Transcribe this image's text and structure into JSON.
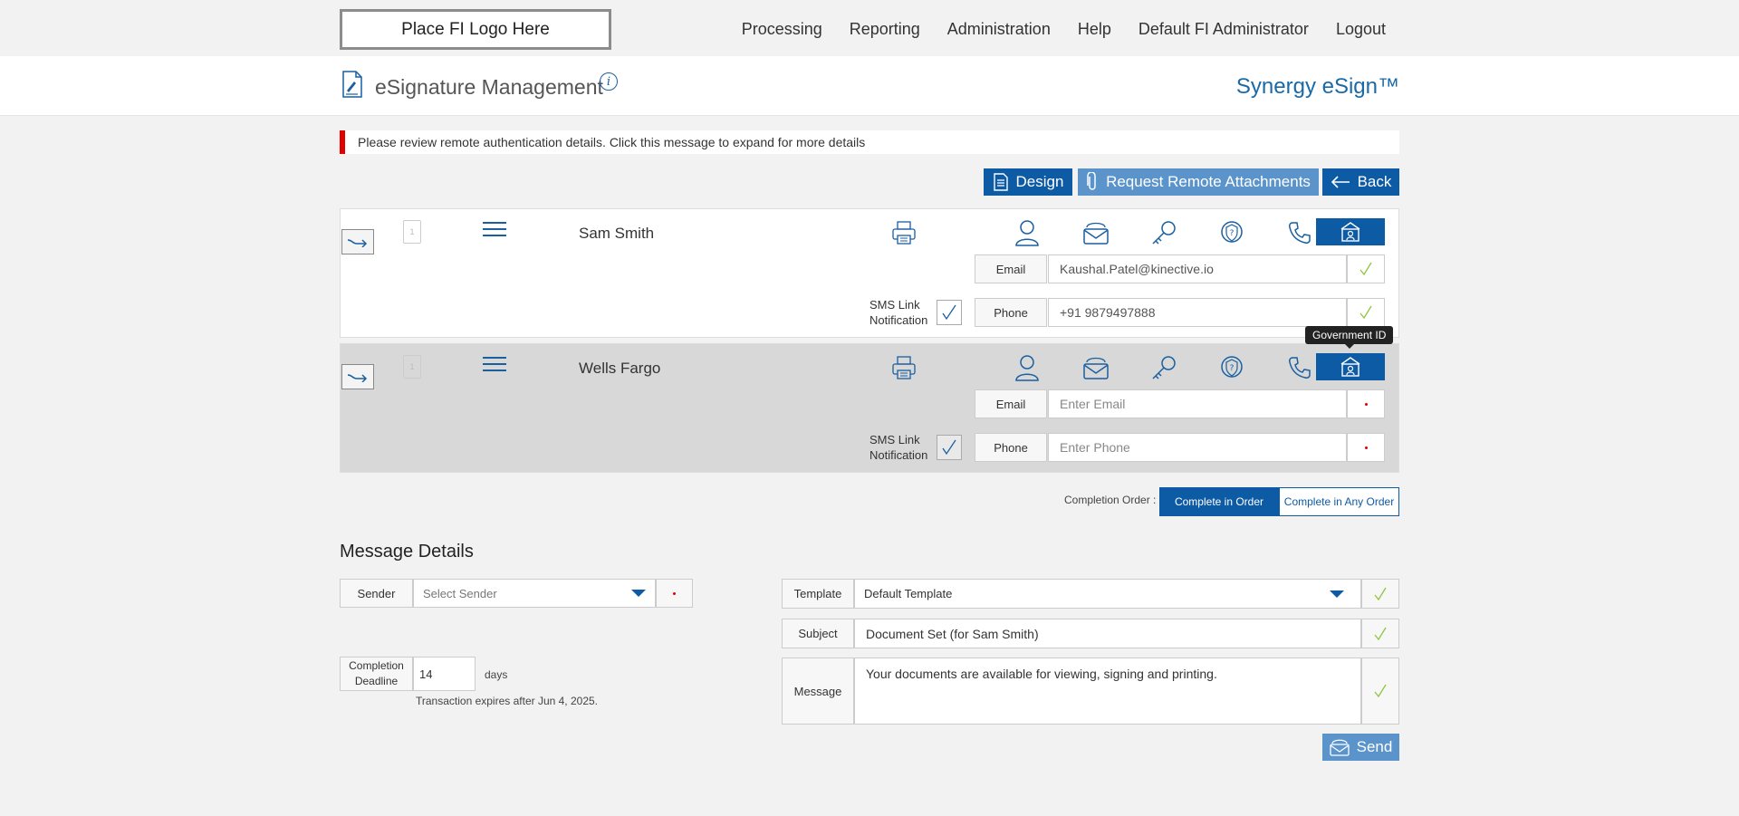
{
  "nav": {
    "logo_text": "Place FI Logo Here",
    "items": [
      "Processing",
      "Reporting",
      "Administration",
      "Help",
      "Default FI Administrator",
      "Logout"
    ]
  },
  "header": {
    "title": "eSignature Management",
    "info_glyph": "i",
    "brand": "Synergy eSign™"
  },
  "alert": {
    "text": "Please review remote authentication details. Click this message to expand for more details"
  },
  "actions": {
    "design": "Design",
    "request_attachments": "Request Remote Attachments",
    "back": "Back"
  },
  "recipients": [
    {
      "name": "Sam Smith",
      "page_number": "1",
      "email_label": "Email",
      "email_value": "Kaushal.Patel@kinective.io",
      "phone_label": "Phone",
      "phone_value": "+91 9879497888",
      "sms_label_1": "SMS Link",
      "sms_label_2": "Notification"
    },
    {
      "name": "Wells Fargo",
      "page_number": "1",
      "email_label": "Email",
      "email_placeholder": "Enter Email",
      "phone_label": "Phone",
      "phone_placeholder": "Enter Phone",
      "sms_label_1": "SMS Link",
      "sms_label_2": "Notification",
      "tooltip": "Government ID"
    }
  ],
  "auth_icons": [
    "user-icon",
    "envelope-icon",
    "key-icon",
    "shield-question-icon",
    "phone-icon",
    "government-id-icon"
  ],
  "completion_order": {
    "label": "Completion Order :",
    "in_order": "Complete in Order",
    "any_order": "Complete in Any Order"
  },
  "message_details": {
    "title": "Message Details",
    "sender_label": "Sender",
    "sender_placeholder": "Select Sender",
    "deadline_label_1": "Completion",
    "deadline_label_2": "Deadline",
    "deadline_value": "14",
    "deadline_unit": "days",
    "expiry_note": "Transaction expires after Jun 4, 2025.",
    "template_label": "Template",
    "template_value": "Default Template",
    "subject_label": "Subject",
    "subject_value": "Document Set (for Sam Smith)",
    "message_label": "Message",
    "message_value": "Your documents are available for viewing, signing and printing.",
    "send": "Send"
  },
  "colors": {
    "primary": "#0d5aa5",
    "primary_light": "#5b93cb",
    "alert_red": "#e00000",
    "check_green": "#8dc63f",
    "brand_blue": "#1a6aa8"
  }
}
